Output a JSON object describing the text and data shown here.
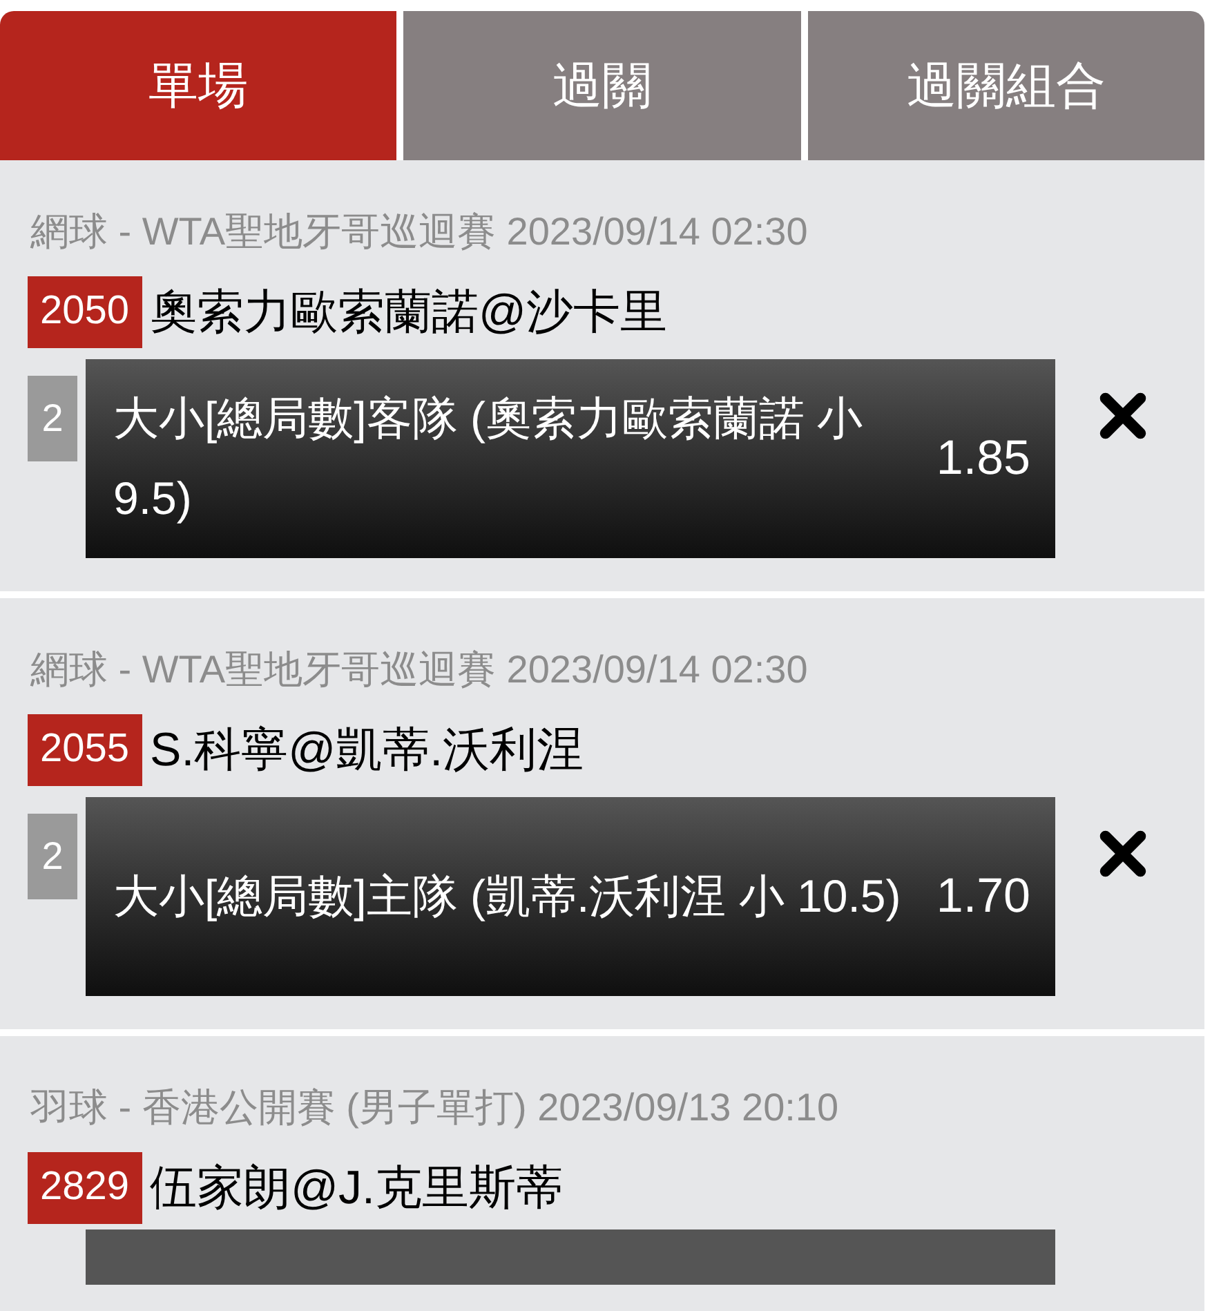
{
  "tabs": [
    {
      "label": "單場",
      "selected": true
    },
    {
      "label": "過關",
      "selected": false
    },
    {
      "label": "過關組合",
      "selected": false
    }
  ],
  "bets": [
    {
      "event": "網球 - WTA聖地牙哥巡迴賽 2023/09/14 02:30",
      "match_no": "2050",
      "match": "奧索力歐索蘭諾@沙卡里",
      "leg": "2",
      "selection": "大小[總局數]客隊 (奧索力歐索蘭諾 小 9.5)",
      "odds": "1.85"
    },
    {
      "event": "網球 - WTA聖地牙哥巡迴賽 2023/09/14 02:30",
      "match_no": "2055",
      "match": "S.科寧@凱蒂.沃利涅",
      "leg": "2",
      "selection": "大小[總局數]主隊 (凱蒂.沃利涅 小 10.5)",
      "odds": "1.70"
    },
    {
      "event": "羽球 - 香港公開賽 (男子單打) 2023/09/13 20:10",
      "match_no": "2829",
      "match": "伍家朗@J.克里斯蒂"
    }
  ]
}
